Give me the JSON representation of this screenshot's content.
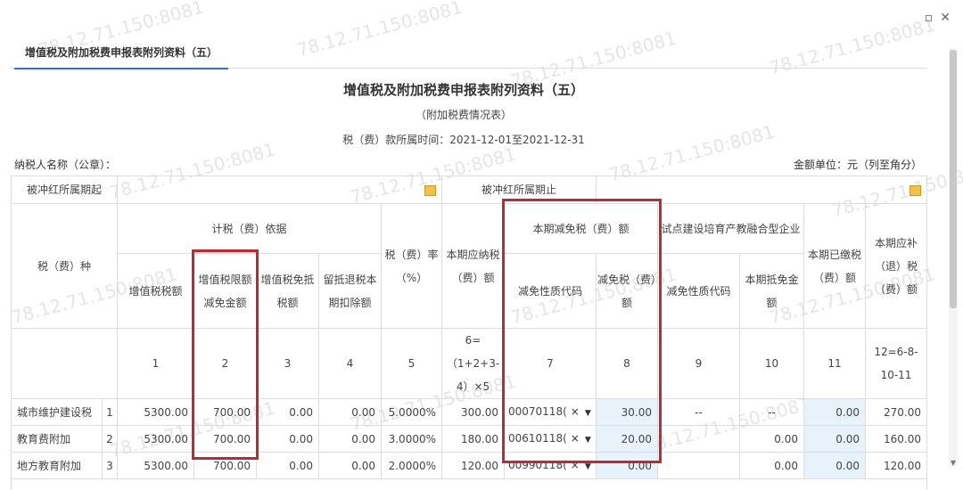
{
  "window": {
    "restore_glyph": "▫",
    "close_glyph": "✕"
  },
  "tab": {
    "label": "增值税及附加税费申报表附列资料（五）"
  },
  "header": {
    "title": "增值税及附加税费申报表附列资料（五）",
    "subtitle": "（附加税费情况表）",
    "period": "税（费）款所属时间：2021-12-01至2021-12-31"
  },
  "taxpayer_label": "纳税人名称（公章）：",
  "unit_label": "金额单位：元（列至角分）",
  "offset": {
    "start_label": "被冲红所属期起",
    "end_label": "被冲红所属期止"
  },
  "columns": {
    "tax_type": "税（费）种",
    "basis_group": "计税（费）依据",
    "c1": "增值税税额",
    "c2": "增值税限额减免金额",
    "c3": "增值税免抵税额",
    "c4": "留抵退税本期扣除额",
    "c5": "税（费）率（%）",
    "c6": "本期应纳税（费）额",
    "relief_group": "本期减免税（费）额",
    "c7": "减免性质代码",
    "c8": "减免税（费）额",
    "pilot_group": "试点建设培育产教融合型企业",
    "c9": "减免性质代码",
    "c10": "本期抵免金额",
    "c11": "本期已缴税（费）额",
    "c12": "本期应补（退）税（费）额"
  },
  "col_numbers": [
    "1",
    "2",
    "3",
    "4",
    "5",
    "6=（1+2+3-4）×5",
    "7",
    "8",
    "9",
    "10",
    "11",
    "12=6-8-10-11"
  ],
  "rows": [
    {
      "name": "城市维护建设税",
      "no": "1",
      "c1": "5300.00",
      "c2": "700.00",
      "c3": "0.00",
      "c4": "0.00",
      "c5": "5.0000%",
      "c6": "300.00",
      "c7": "00070118(",
      "c8": "30.00",
      "c9": "--",
      "c10": "--",
      "c11": "0.00",
      "c12": "270.00"
    },
    {
      "name": "教育费附加",
      "no": "2",
      "c1": "5300.00",
      "c2": "700.00",
      "c3": "0.00",
      "c4": "0.00",
      "c5": "3.0000%",
      "c6": "180.00",
      "c7": "00610118(",
      "c8": "20.00",
      "c9": "",
      "c10": "0.00",
      "c11": "0.00",
      "c12": "160.00"
    },
    {
      "name": "地方教育附加",
      "no": "3",
      "c1": "5300.00",
      "c2": "700.00",
      "c3": "0.00",
      "c4": "0.00",
      "c5": "2.0000%",
      "c6": "120.00",
      "c7": "00990118(",
      "c8": "0.00",
      "c9": "",
      "c10": "0.00",
      "c11": "0.00",
      "c12": "120.00"
    }
  ],
  "watermark": "78.12.71.150:8081",
  "colors": {
    "accent": "#2b74c7",
    "highlight": "#c9252c",
    "shade": "#e8f2fb"
  }
}
